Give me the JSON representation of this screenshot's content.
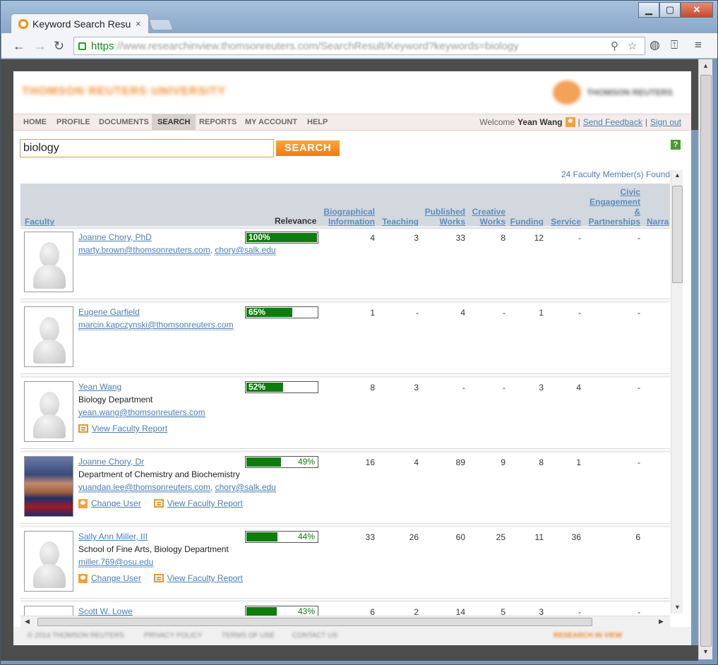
{
  "browser": {
    "tab_title": "Keyword Search Resu",
    "tab_close": "×",
    "url_scheme": "https",
    "url_rest": "://www.researchinview.thomsonreuters.com/SearchResult/Keyword?keywords=biology",
    "back": "←",
    "forward": "→",
    "reload": "↻",
    "minimize": "▁",
    "maximize": "▢",
    "close": "✕",
    "zoom_icon": "⚲",
    "star_icon": "☆",
    "menu_icon": "≡"
  },
  "site": {
    "logo_left": "THOMSON REUTERS UNIVERSITY",
    "logo_right": "THOMSON REUTERS"
  },
  "nav": {
    "items": [
      "HOME",
      "PROFILE",
      "DOCUMENTS",
      "SEARCH",
      "REPORTS",
      "MY ACCOUNT",
      "HELP"
    ],
    "active": "SEARCH",
    "welcome_prefix": "Welcome",
    "user": "Yean Wang",
    "sep": "|",
    "feedback": "Send Feedback",
    "signout": "Sign out"
  },
  "search": {
    "value": "biology",
    "button": "SEARCH",
    "help": "?",
    "result_count": "24 Faculty Member(s) Found"
  },
  "columns": {
    "faculty": "Faculty",
    "relevance": "Relevance",
    "bio": [
      "Biographical",
      "Information"
    ],
    "teaching": "Teaching",
    "published": [
      "Published",
      "Works"
    ],
    "creative": [
      "Creative",
      "Works"
    ],
    "funding": "Funding",
    "service": "Service",
    "civic": [
      "Civic",
      "Engagement",
      "&",
      "Partnerships"
    ],
    "narrative": "Narra"
  },
  "rows": [
    {
      "name": "Joanne Chory, PhD",
      "dept": "",
      "emails": [
        "marty.brown@thomsonreuters.com",
        "chory@salk.edu"
      ],
      "relevance": 100,
      "relevance_label": "100%",
      "bio": "4",
      "teaching": "3",
      "published": "33",
      "creative": "8",
      "funding": "12",
      "service": "-",
      "civic": "-",
      "change_user": "",
      "report": ""
    },
    {
      "name": "Eugene Garfield",
      "dept": "",
      "emails": [
        "marcin.kapczynski@thomsonreuters.com"
      ],
      "relevance": 65,
      "relevance_label": "65%",
      "bio": "1",
      "teaching": "-",
      "published": "4",
      "creative": "-",
      "funding": "1",
      "service": "-",
      "civic": "-",
      "change_user": "",
      "report": ""
    },
    {
      "name": "Yean Wang",
      "dept": "Biology Department",
      "emails": [
        "yean.wang@thomsonreuters.com"
      ],
      "relevance": 52,
      "relevance_label": "52%",
      "bio": "8",
      "teaching": "3",
      "published": "-",
      "creative": "-",
      "funding": "3",
      "service": "4",
      "civic": "-",
      "change_user": "",
      "report": "View Faculty Report"
    },
    {
      "name": "Joanne Chory, Dr",
      "dept": "Department of Chemistry and Biochemistry",
      "emails": [
        "yuandan.lee@thomsonreuters.com",
        "chory@salk.edu"
      ],
      "relevance": 49,
      "relevance_label": "49%",
      "bio": "16",
      "teaching": "4",
      "published": "89",
      "creative": "9",
      "funding": "8",
      "service": "1",
      "civic": "-",
      "change_user": "Change User",
      "report": "View Faculty Report",
      "photo": true
    },
    {
      "name": "Sally Ann Miller, III",
      "dept": "School of Fine Arts, Biology Department",
      "emails": [
        "miller.769@osu.edu"
      ],
      "relevance": 44,
      "relevance_label": "44%",
      "bio": "33",
      "teaching": "26",
      "published": "60",
      "creative": "25",
      "funding": "11",
      "service": "36",
      "civic": "6",
      "change_user": "Change User",
      "report": "View Faculty Report"
    },
    {
      "name": "Scott W. Lowe",
      "dept": "",
      "emails": [],
      "relevance": 43,
      "relevance_label": "43%",
      "bio": "6",
      "teaching": "2",
      "published": "14",
      "creative": "5",
      "funding": "3",
      "service": "-",
      "civic": "-",
      "change_user": "",
      "report": ""
    }
  ],
  "footer": {
    "items": [
      "© 2014 THOMSON REUTERS",
      "PRIVACY POLICY",
      "TERMS OF USE",
      "CONTACT US"
    ],
    "right": "RESEARCH IN VIEW"
  },
  "colors": {
    "accent": "#f07b0f",
    "link": "#4a7eb5",
    "relevance_bar": "#0d7d0d"
  }
}
